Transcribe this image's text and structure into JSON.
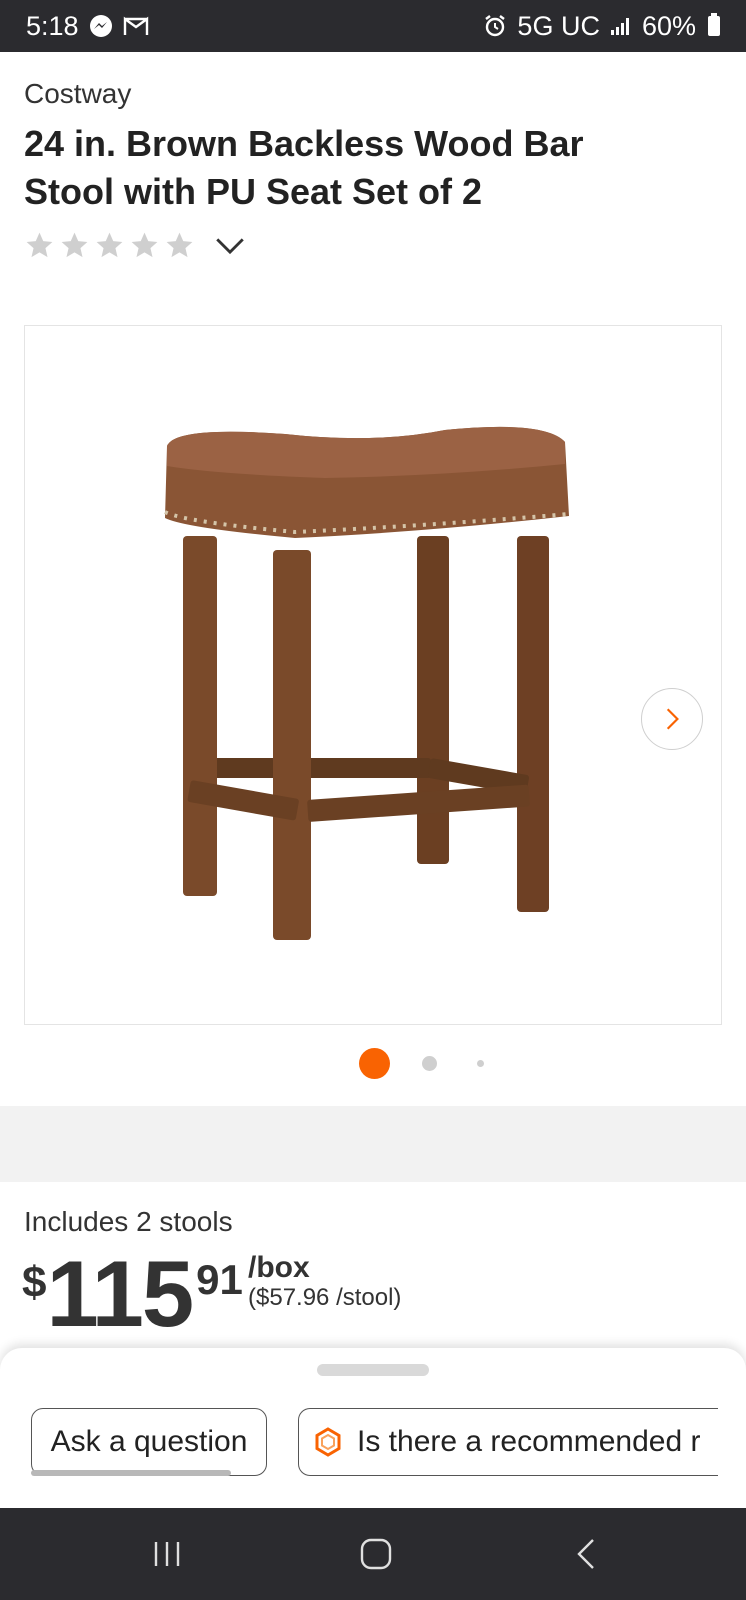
{
  "status_bar": {
    "time": "5:18",
    "network": "5G UC",
    "battery": "60%",
    "icons": [
      "messenger-icon",
      "gmail-icon",
      "alarm-icon",
      "signal-icon",
      "battery-icon"
    ]
  },
  "product": {
    "brand": "Costway",
    "title": "24 in. Brown Backless Wood Bar Stool with PU Seat Set of 2",
    "rating": {
      "stars": 5,
      "filled": 0
    }
  },
  "gallery": {
    "image_subject": "stool",
    "dots": [
      {
        "state": "active"
      },
      {
        "state": "inactive"
      },
      {
        "state": "inactive-small"
      }
    ]
  },
  "pricing": {
    "includes": "Includes 2 stools",
    "dollar_sign": "$",
    "whole": "115",
    "cents": "91",
    "unit": "/box",
    "unit_price": "($57.96 /stool)"
  },
  "bottom_sheet": {
    "ask_button": "Ask a question",
    "suggestion": "Is there a recommended r"
  },
  "colors": {
    "accent": "#f96302",
    "status_bar": "#2b2b2f",
    "star_empty": "#cfcfcf"
  }
}
